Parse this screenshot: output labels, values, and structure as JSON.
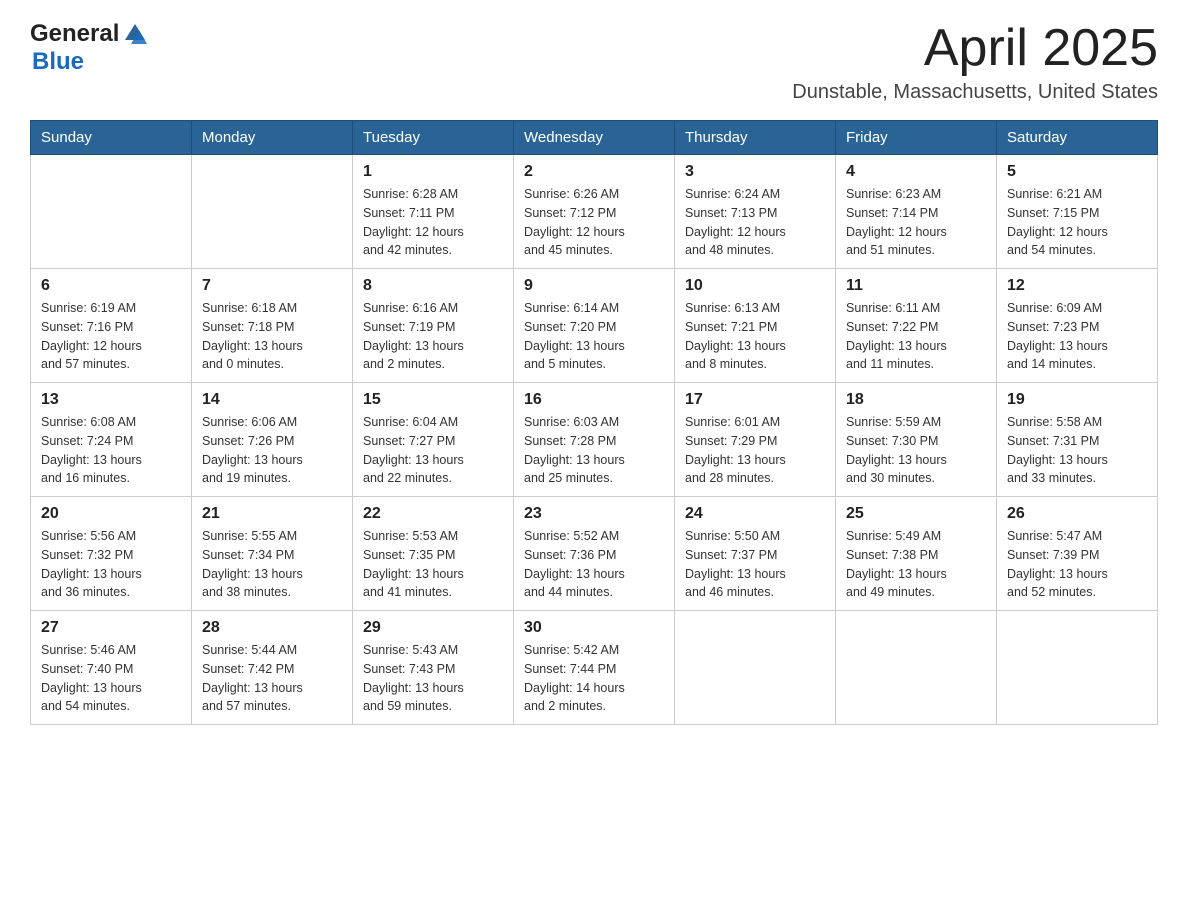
{
  "header": {
    "logo_general": "General",
    "logo_blue": "Blue",
    "month_title": "April 2025",
    "location": "Dunstable, Massachusetts, United States"
  },
  "days_of_week": [
    "Sunday",
    "Monday",
    "Tuesday",
    "Wednesday",
    "Thursday",
    "Friday",
    "Saturday"
  ],
  "weeks": [
    [
      {
        "day": "",
        "info": ""
      },
      {
        "day": "",
        "info": ""
      },
      {
        "day": "1",
        "info": "Sunrise: 6:28 AM\nSunset: 7:11 PM\nDaylight: 12 hours\nand 42 minutes."
      },
      {
        "day": "2",
        "info": "Sunrise: 6:26 AM\nSunset: 7:12 PM\nDaylight: 12 hours\nand 45 minutes."
      },
      {
        "day": "3",
        "info": "Sunrise: 6:24 AM\nSunset: 7:13 PM\nDaylight: 12 hours\nand 48 minutes."
      },
      {
        "day": "4",
        "info": "Sunrise: 6:23 AM\nSunset: 7:14 PM\nDaylight: 12 hours\nand 51 minutes."
      },
      {
        "day": "5",
        "info": "Sunrise: 6:21 AM\nSunset: 7:15 PM\nDaylight: 12 hours\nand 54 minutes."
      }
    ],
    [
      {
        "day": "6",
        "info": "Sunrise: 6:19 AM\nSunset: 7:16 PM\nDaylight: 12 hours\nand 57 minutes."
      },
      {
        "day": "7",
        "info": "Sunrise: 6:18 AM\nSunset: 7:18 PM\nDaylight: 13 hours\nand 0 minutes."
      },
      {
        "day": "8",
        "info": "Sunrise: 6:16 AM\nSunset: 7:19 PM\nDaylight: 13 hours\nand 2 minutes."
      },
      {
        "day": "9",
        "info": "Sunrise: 6:14 AM\nSunset: 7:20 PM\nDaylight: 13 hours\nand 5 minutes."
      },
      {
        "day": "10",
        "info": "Sunrise: 6:13 AM\nSunset: 7:21 PM\nDaylight: 13 hours\nand 8 minutes."
      },
      {
        "day": "11",
        "info": "Sunrise: 6:11 AM\nSunset: 7:22 PM\nDaylight: 13 hours\nand 11 minutes."
      },
      {
        "day": "12",
        "info": "Sunrise: 6:09 AM\nSunset: 7:23 PM\nDaylight: 13 hours\nand 14 minutes."
      }
    ],
    [
      {
        "day": "13",
        "info": "Sunrise: 6:08 AM\nSunset: 7:24 PM\nDaylight: 13 hours\nand 16 minutes."
      },
      {
        "day": "14",
        "info": "Sunrise: 6:06 AM\nSunset: 7:26 PM\nDaylight: 13 hours\nand 19 minutes."
      },
      {
        "day": "15",
        "info": "Sunrise: 6:04 AM\nSunset: 7:27 PM\nDaylight: 13 hours\nand 22 minutes."
      },
      {
        "day": "16",
        "info": "Sunrise: 6:03 AM\nSunset: 7:28 PM\nDaylight: 13 hours\nand 25 minutes."
      },
      {
        "day": "17",
        "info": "Sunrise: 6:01 AM\nSunset: 7:29 PM\nDaylight: 13 hours\nand 28 minutes."
      },
      {
        "day": "18",
        "info": "Sunrise: 5:59 AM\nSunset: 7:30 PM\nDaylight: 13 hours\nand 30 minutes."
      },
      {
        "day": "19",
        "info": "Sunrise: 5:58 AM\nSunset: 7:31 PM\nDaylight: 13 hours\nand 33 minutes."
      }
    ],
    [
      {
        "day": "20",
        "info": "Sunrise: 5:56 AM\nSunset: 7:32 PM\nDaylight: 13 hours\nand 36 minutes."
      },
      {
        "day": "21",
        "info": "Sunrise: 5:55 AM\nSunset: 7:34 PM\nDaylight: 13 hours\nand 38 minutes."
      },
      {
        "day": "22",
        "info": "Sunrise: 5:53 AM\nSunset: 7:35 PM\nDaylight: 13 hours\nand 41 minutes."
      },
      {
        "day": "23",
        "info": "Sunrise: 5:52 AM\nSunset: 7:36 PM\nDaylight: 13 hours\nand 44 minutes."
      },
      {
        "day": "24",
        "info": "Sunrise: 5:50 AM\nSunset: 7:37 PM\nDaylight: 13 hours\nand 46 minutes."
      },
      {
        "day": "25",
        "info": "Sunrise: 5:49 AM\nSunset: 7:38 PM\nDaylight: 13 hours\nand 49 minutes."
      },
      {
        "day": "26",
        "info": "Sunrise: 5:47 AM\nSunset: 7:39 PM\nDaylight: 13 hours\nand 52 minutes."
      }
    ],
    [
      {
        "day": "27",
        "info": "Sunrise: 5:46 AM\nSunset: 7:40 PM\nDaylight: 13 hours\nand 54 minutes."
      },
      {
        "day": "28",
        "info": "Sunrise: 5:44 AM\nSunset: 7:42 PM\nDaylight: 13 hours\nand 57 minutes."
      },
      {
        "day": "29",
        "info": "Sunrise: 5:43 AM\nSunset: 7:43 PM\nDaylight: 13 hours\nand 59 minutes."
      },
      {
        "day": "30",
        "info": "Sunrise: 5:42 AM\nSunset: 7:44 PM\nDaylight: 14 hours\nand 2 minutes."
      },
      {
        "day": "",
        "info": ""
      },
      {
        "day": "",
        "info": ""
      },
      {
        "day": "",
        "info": ""
      }
    ]
  ]
}
